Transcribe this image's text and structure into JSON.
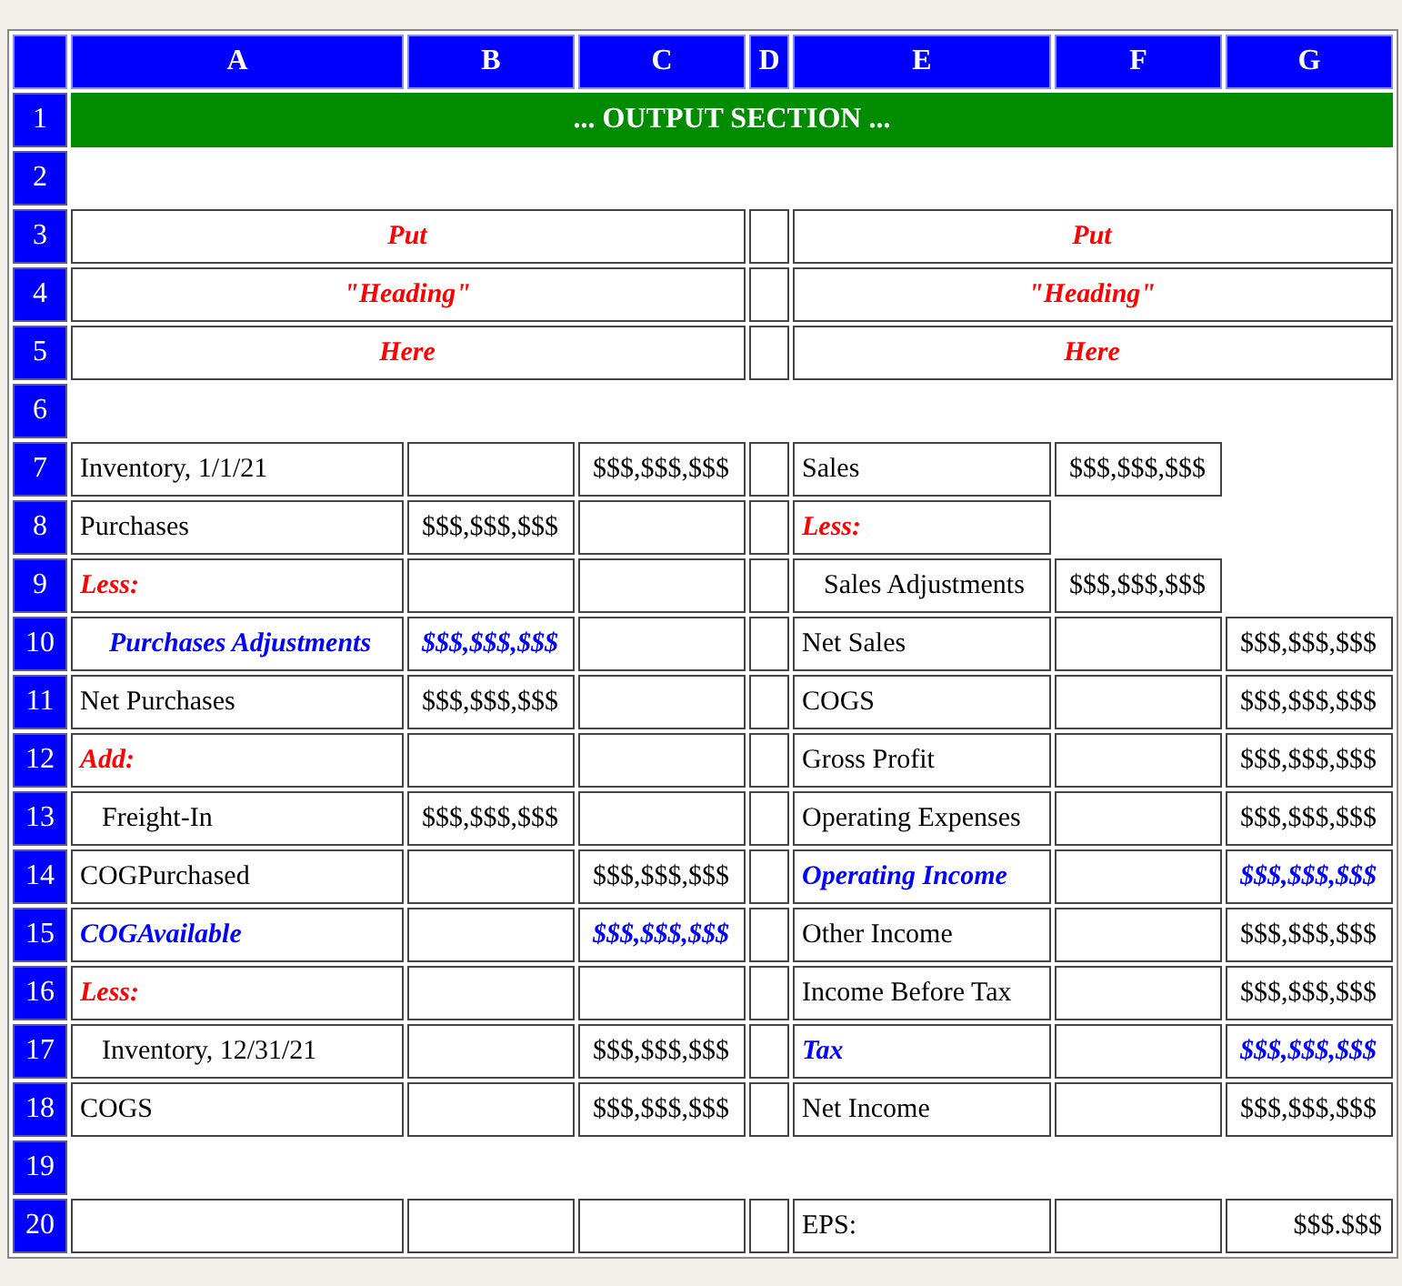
{
  "columns": [
    "A",
    "B",
    "C",
    "D",
    "E",
    "F",
    "G"
  ],
  "rows": [
    {
      "number": "1",
      "kind": "banner",
      "text": "... OUTPUT SECTION ..."
    },
    {
      "number": "2",
      "kind": "spacer"
    },
    {
      "number": "3",
      "kind": "heading",
      "left": "Put",
      "right": "Put"
    },
    {
      "number": "4",
      "kind": "heading",
      "left": "\"Heading\"",
      "right": "\"Heading\""
    },
    {
      "number": "5",
      "kind": "heading",
      "left": "Here",
      "right": "Here"
    },
    {
      "number": "6",
      "kind": "spacer"
    },
    {
      "number": "7",
      "kind": "line",
      "cells": [
        {
          "kind": "label",
          "text": "Inventory, 1/1/21"
        },
        {
          "kind": "empty"
        },
        {
          "kind": "amount",
          "text": "$$$,$$$,$$$"
        },
        {
          "kind": "empty"
        },
        {
          "kind": "label",
          "text": "Sales"
        },
        {
          "kind": "amount",
          "text": "$$$,$$$,$$$"
        },
        {
          "kind": "none"
        }
      ]
    },
    {
      "number": "8",
      "kind": "line",
      "cells": [
        {
          "kind": "label",
          "text": "Purchases"
        },
        {
          "kind": "amount",
          "text": "$$$,$$$,$$$"
        },
        {
          "kind": "empty"
        },
        {
          "kind": "empty"
        },
        {
          "kind": "note",
          "text": "Less:"
        },
        {
          "kind": "none"
        },
        {
          "kind": "none"
        }
      ]
    },
    {
      "number": "9",
      "kind": "line",
      "cells": [
        {
          "kind": "note",
          "text": "Less:"
        },
        {
          "kind": "empty"
        },
        {
          "kind": "empty"
        },
        {
          "kind": "empty"
        },
        {
          "kind": "sub-label",
          "text": "Sales Adjustments"
        },
        {
          "kind": "amount",
          "text": "$$$,$$$,$$$"
        },
        {
          "kind": "none"
        }
      ]
    },
    {
      "number": "10",
      "kind": "line",
      "cells": [
        {
          "kind": "key-sub-label",
          "text": "Purchases Adjustments"
        },
        {
          "kind": "key-amount",
          "text": "$$$,$$$,$$$"
        },
        {
          "kind": "empty"
        },
        {
          "kind": "empty"
        },
        {
          "kind": "label",
          "text": "Net Sales"
        },
        {
          "kind": "empty"
        },
        {
          "kind": "amount",
          "text": "$$$,$$$,$$$"
        }
      ]
    },
    {
      "number": "11",
      "kind": "line",
      "cells": [
        {
          "kind": "label",
          "text": "Net Purchases"
        },
        {
          "kind": "amount",
          "text": "$$$,$$$,$$$"
        },
        {
          "kind": "empty"
        },
        {
          "kind": "empty"
        },
        {
          "kind": "label",
          "text": "COGS"
        },
        {
          "kind": "empty"
        },
        {
          "kind": "amount",
          "text": "$$$,$$$,$$$"
        }
      ]
    },
    {
      "number": "12",
      "kind": "line",
      "cells": [
        {
          "kind": "note",
          "text": "Add:"
        },
        {
          "kind": "empty"
        },
        {
          "kind": "empty"
        },
        {
          "kind": "empty"
        },
        {
          "kind": "label",
          "text": "Gross Profit"
        },
        {
          "kind": "empty"
        },
        {
          "kind": "amount",
          "text": "$$$,$$$,$$$"
        }
      ]
    },
    {
      "number": "13",
      "kind": "line",
      "cells": [
        {
          "kind": "sub-label",
          "text": "Freight-In"
        },
        {
          "kind": "amount",
          "text": "$$$,$$$,$$$"
        },
        {
          "kind": "empty"
        },
        {
          "kind": "empty"
        },
        {
          "kind": "label",
          "text": "Operating Expenses"
        },
        {
          "kind": "empty"
        },
        {
          "kind": "amount",
          "text": "$$$,$$$,$$$"
        }
      ]
    },
    {
      "number": "14",
      "kind": "line",
      "cells": [
        {
          "kind": "label",
          "text": "COGPurchased"
        },
        {
          "kind": "empty"
        },
        {
          "kind": "amount",
          "text": "$$$,$$$,$$$"
        },
        {
          "kind": "empty"
        },
        {
          "kind": "key-label",
          "text": "Operating Income"
        },
        {
          "kind": "empty"
        },
        {
          "kind": "key-amount",
          "text": "$$$,$$$,$$$"
        }
      ]
    },
    {
      "number": "15",
      "kind": "line",
      "cells": [
        {
          "kind": "key-label",
          "text": "COGAvailable"
        },
        {
          "kind": "empty"
        },
        {
          "kind": "key-amount",
          "text": "$$$,$$$,$$$"
        },
        {
          "kind": "empty"
        },
        {
          "kind": "label",
          "text": "Other Income"
        },
        {
          "kind": "empty"
        },
        {
          "kind": "amount",
          "text": "$$$,$$$,$$$"
        }
      ]
    },
    {
      "number": "16",
      "kind": "line",
      "cells": [
        {
          "kind": "note",
          "text": "Less:"
        },
        {
          "kind": "empty"
        },
        {
          "kind": "empty"
        },
        {
          "kind": "empty"
        },
        {
          "kind": "label",
          "text": "Income Before Tax"
        },
        {
          "kind": "empty"
        },
        {
          "kind": "amount",
          "text": "$$$,$$$,$$$"
        }
      ]
    },
    {
      "number": "17",
      "kind": "line",
      "cells": [
        {
          "kind": "sub-label",
          "text": "Inventory, 12/31/21"
        },
        {
          "kind": "empty"
        },
        {
          "kind": "amount",
          "text": "$$$,$$$,$$$"
        },
        {
          "kind": "empty"
        },
        {
          "kind": "key-label",
          "text": "Tax"
        },
        {
          "kind": "empty"
        },
        {
          "kind": "key-amount",
          "text": "$$$,$$$,$$$"
        }
      ]
    },
    {
      "number": "18",
      "kind": "line",
      "cells": [
        {
          "kind": "label",
          "text": "COGS"
        },
        {
          "kind": "empty"
        },
        {
          "kind": "amount",
          "text": "$$$,$$$,$$$"
        },
        {
          "kind": "empty"
        },
        {
          "kind": "label",
          "text": "Net Income"
        },
        {
          "kind": "empty"
        },
        {
          "kind": "amount",
          "text": "$$$,$$$,$$$"
        }
      ]
    },
    {
      "number": "19",
      "kind": "spacer"
    },
    {
      "number": "20",
      "kind": "line",
      "cells": [
        {
          "kind": "empty"
        },
        {
          "kind": "empty"
        },
        {
          "kind": "empty"
        },
        {
          "kind": "empty"
        },
        {
          "kind": "label",
          "text": "EPS:"
        },
        {
          "kind": "empty"
        },
        {
          "kind": "per-share",
          "text": "$$$.$$$"
        }
      ]
    }
  ]
}
